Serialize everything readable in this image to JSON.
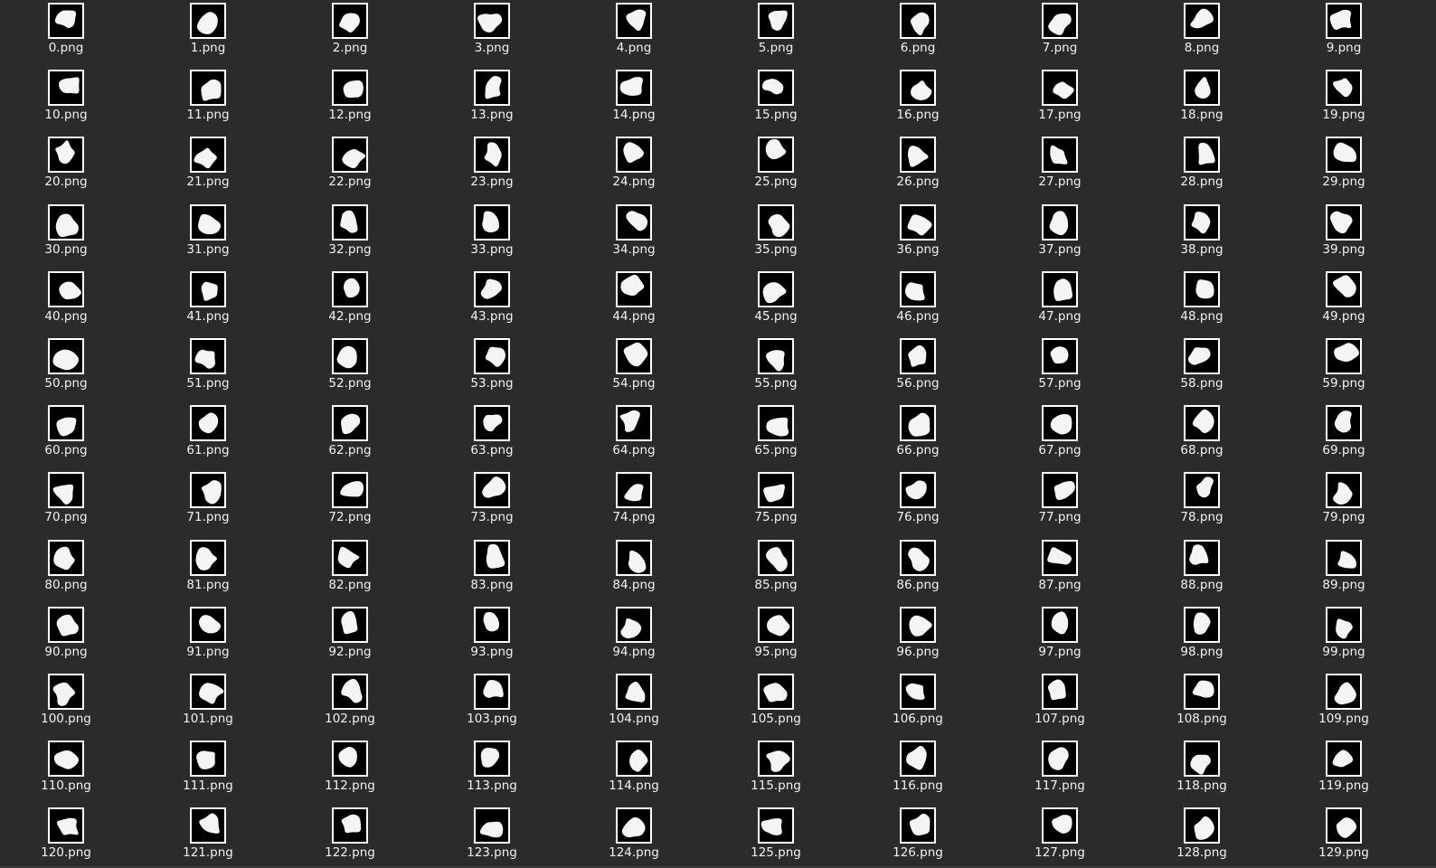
{
  "window": {
    "background_color": "#2b2b2b",
    "thumbnail_background": "#000000",
    "thumbnail_border": "#ffffff",
    "label_color": "#f2f2f2"
  },
  "files": [
    {
      "name": "0.png"
    },
    {
      "name": "1.png"
    },
    {
      "name": "2.png"
    },
    {
      "name": "3.png"
    },
    {
      "name": "4.png"
    },
    {
      "name": "5.png"
    },
    {
      "name": "6.png"
    },
    {
      "name": "7.png"
    },
    {
      "name": "8.png"
    },
    {
      "name": "9.png"
    },
    {
      "name": "10.png"
    },
    {
      "name": "11.png"
    },
    {
      "name": "12.png"
    },
    {
      "name": "13.png"
    },
    {
      "name": "14.png"
    },
    {
      "name": "15.png"
    },
    {
      "name": "16.png"
    },
    {
      "name": "17.png"
    },
    {
      "name": "18.png"
    },
    {
      "name": "19.png"
    },
    {
      "name": "20.png"
    },
    {
      "name": "21.png"
    },
    {
      "name": "22.png"
    },
    {
      "name": "23.png"
    },
    {
      "name": "24.png"
    },
    {
      "name": "25.png"
    },
    {
      "name": "26.png"
    },
    {
      "name": "27.png"
    },
    {
      "name": "28.png"
    },
    {
      "name": "29.png"
    },
    {
      "name": "30.png"
    },
    {
      "name": "31.png"
    },
    {
      "name": "32.png"
    },
    {
      "name": "33.png"
    },
    {
      "name": "34.png"
    },
    {
      "name": "35.png"
    },
    {
      "name": "36.png"
    },
    {
      "name": "37.png"
    },
    {
      "name": "38.png"
    },
    {
      "name": "39.png"
    },
    {
      "name": "40.png"
    },
    {
      "name": "41.png"
    },
    {
      "name": "42.png"
    },
    {
      "name": "43.png"
    },
    {
      "name": "44.png"
    },
    {
      "name": "45.png"
    },
    {
      "name": "46.png"
    },
    {
      "name": "47.png"
    },
    {
      "name": "48.png"
    },
    {
      "name": "49.png"
    },
    {
      "name": "50.png"
    },
    {
      "name": "51.png"
    },
    {
      "name": "52.png"
    },
    {
      "name": "53.png"
    },
    {
      "name": "54.png"
    },
    {
      "name": "55.png"
    },
    {
      "name": "56.png"
    },
    {
      "name": "57.png"
    },
    {
      "name": "58.png"
    },
    {
      "name": "59.png"
    },
    {
      "name": "60.png"
    },
    {
      "name": "61.png"
    },
    {
      "name": "62.png"
    },
    {
      "name": "63.png"
    },
    {
      "name": "64.png"
    },
    {
      "name": "65.png"
    },
    {
      "name": "66.png"
    },
    {
      "name": "67.png"
    },
    {
      "name": "68.png"
    },
    {
      "name": "69.png"
    },
    {
      "name": "70.png"
    },
    {
      "name": "71.png"
    },
    {
      "name": "72.png"
    },
    {
      "name": "73.png"
    },
    {
      "name": "74.png"
    },
    {
      "name": "75.png"
    },
    {
      "name": "76.png"
    },
    {
      "name": "77.png"
    },
    {
      "name": "78.png"
    },
    {
      "name": "79.png"
    },
    {
      "name": "80.png"
    },
    {
      "name": "81.png"
    },
    {
      "name": "82.png"
    },
    {
      "name": "83.png"
    },
    {
      "name": "84.png"
    },
    {
      "name": "85.png"
    },
    {
      "name": "86.png"
    },
    {
      "name": "87.png"
    },
    {
      "name": "88.png"
    },
    {
      "name": "89.png"
    },
    {
      "name": "90.png"
    },
    {
      "name": "91.png"
    },
    {
      "name": "92.png"
    },
    {
      "name": "93.png"
    },
    {
      "name": "94.png"
    },
    {
      "name": "95.png"
    },
    {
      "name": "96.png"
    },
    {
      "name": "97.png"
    },
    {
      "name": "98.png"
    },
    {
      "name": "99.png"
    },
    {
      "name": "100.png"
    },
    {
      "name": "101.png"
    },
    {
      "name": "102.png"
    },
    {
      "name": "103.png"
    },
    {
      "name": "104.png"
    },
    {
      "name": "105.png"
    },
    {
      "name": "106.png"
    },
    {
      "name": "107.png"
    },
    {
      "name": "108.png"
    },
    {
      "name": "109.png"
    },
    {
      "name": "110.png"
    },
    {
      "name": "111.png"
    },
    {
      "name": "112.png"
    },
    {
      "name": "113.png"
    },
    {
      "name": "114.png"
    },
    {
      "name": "115.png"
    },
    {
      "name": "116.png"
    },
    {
      "name": "117.png"
    },
    {
      "name": "118.png"
    },
    {
      "name": "119.png"
    },
    {
      "name": "120.png"
    },
    {
      "name": "121.png"
    },
    {
      "name": "122.png"
    },
    {
      "name": "123.png"
    },
    {
      "name": "124.png"
    },
    {
      "name": "125.png"
    },
    {
      "name": "126.png"
    },
    {
      "name": "127.png"
    },
    {
      "name": "128.png"
    },
    {
      "name": "129.png"
    }
  ]
}
